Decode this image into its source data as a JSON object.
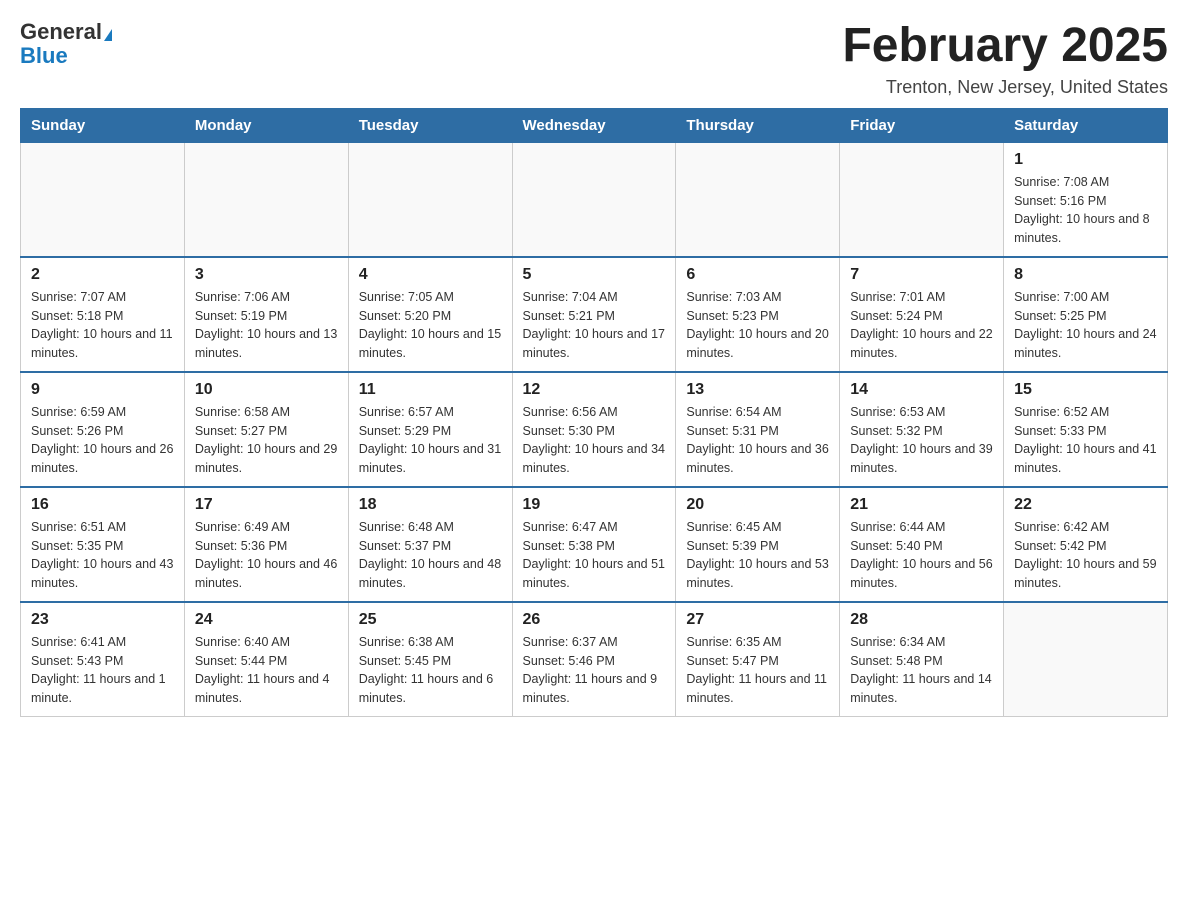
{
  "logo": {
    "general": "General",
    "blue": "Blue",
    "triangle": "▲"
  },
  "title": {
    "month_year": "February 2025",
    "location": "Trenton, New Jersey, United States"
  },
  "weekdays": [
    "Sunday",
    "Monday",
    "Tuesday",
    "Wednesday",
    "Thursday",
    "Friday",
    "Saturday"
  ],
  "weeks": [
    [
      {
        "day": "",
        "info": ""
      },
      {
        "day": "",
        "info": ""
      },
      {
        "day": "",
        "info": ""
      },
      {
        "day": "",
        "info": ""
      },
      {
        "day": "",
        "info": ""
      },
      {
        "day": "",
        "info": ""
      },
      {
        "day": "1",
        "info": "Sunrise: 7:08 AM\nSunset: 5:16 PM\nDaylight: 10 hours and 8 minutes."
      }
    ],
    [
      {
        "day": "2",
        "info": "Sunrise: 7:07 AM\nSunset: 5:18 PM\nDaylight: 10 hours and 11 minutes."
      },
      {
        "day": "3",
        "info": "Sunrise: 7:06 AM\nSunset: 5:19 PM\nDaylight: 10 hours and 13 minutes."
      },
      {
        "day": "4",
        "info": "Sunrise: 7:05 AM\nSunset: 5:20 PM\nDaylight: 10 hours and 15 minutes."
      },
      {
        "day": "5",
        "info": "Sunrise: 7:04 AM\nSunset: 5:21 PM\nDaylight: 10 hours and 17 minutes."
      },
      {
        "day": "6",
        "info": "Sunrise: 7:03 AM\nSunset: 5:23 PM\nDaylight: 10 hours and 20 minutes."
      },
      {
        "day": "7",
        "info": "Sunrise: 7:01 AM\nSunset: 5:24 PM\nDaylight: 10 hours and 22 minutes."
      },
      {
        "day": "8",
        "info": "Sunrise: 7:00 AM\nSunset: 5:25 PM\nDaylight: 10 hours and 24 minutes."
      }
    ],
    [
      {
        "day": "9",
        "info": "Sunrise: 6:59 AM\nSunset: 5:26 PM\nDaylight: 10 hours and 26 minutes."
      },
      {
        "day": "10",
        "info": "Sunrise: 6:58 AM\nSunset: 5:27 PM\nDaylight: 10 hours and 29 minutes."
      },
      {
        "day": "11",
        "info": "Sunrise: 6:57 AM\nSunset: 5:29 PM\nDaylight: 10 hours and 31 minutes."
      },
      {
        "day": "12",
        "info": "Sunrise: 6:56 AM\nSunset: 5:30 PM\nDaylight: 10 hours and 34 minutes."
      },
      {
        "day": "13",
        "info": "Sunrise: 6:54 AM\nSunset: 5:31 PM\nDaylight: 10 hours and 36 minutes."
      },
      {
        "day": "14",
        "info": "Sunrise: 6:53 AM\nSunset: 5:32 PM\nDaylight: 10 hours and 39 minutes."
      },
      {
        "day": "15",
        "info": "Sunrise: 6:52 AM\nSunset: 5:33 PM\nDaylight: 10 hours and 41 minutes."
      }
    ],
    [
      {
        "day": "16",
        "info": "Sunrise: 6:51 AM\nSunset: 5:35 PM\nDaylight: 10 hours and 43 minutes."
      },
      {
        "day": "17",
        "info": "Sunrise: 6:49 AM\nSunset: 5:36 PM\nDaylight: 10 hours and 46 minutes."
      },
      {
        "day": "18",
        "info": "Sunrise: 6:48 AM\nSunset: 5:37 PM\nDaylight: 10 hours and 48 minutes."
      },
      {
        "day": "19",
        "info": "Sunrise: 6:47 AM\nSunset: 5:38 PM\nDaylight: 10 hours and 51 minutes."
      },
      {
        "day": "20",
        "info": "Sunrise: 6:45 AM\nSunset: 5:39 PM\nDaylight: 10 hours and 53 minutes."
      },
      {
        "day": "21",
        "info": "Sunrise: 6:44 AM\nSunset: 5:40 PM\nDaylight: 10 hours and 56 minutes."
      },
      {
        "day": "22",
        "info": "Sunrise: 6:42 AM\nSunset: 5:42 PM\nDaylight: 10 hours and 59 minutes."
      }
    ],
    [
      {
        "day": "23",
        "info": "Sunrise: 6:41 AM\nSunset: 5:43 PM\nDaylight: 11 hours and 1 minute."
      },
      {
        "day": "24",
        "info": "Sunrise: 6:40 AM\nSunset: 5:44 PM\nDaylight: 11 hours and 4 minutes."
      },
      {
        "day": "25",
        "info": "Sunrise: 6:38 AM\nSunset: 5:45 PM\nDaylight: 11 hours and 6 minutes."
      },
      {
        "day": "26",
        "info": "Sunrise: 6:37 AM\nSunset: 5:46 PM\nDaylight: 11 hours and 9 minutes."
      },
      {
        "day": "27",
        "info": "Sunrise: 6:35 AM\nSunset: 5:47 PM\nDaylight: 11 hours and 11 minutes."
      },
      {
        "day": "28",
        "info": "Sunrise: 6:34 AM\nSunset: 5:48 PM\nDaylight: 11 hours and 14 minutes."
      },
      {
        "day": "",
        "info": ""
      }
    ]
  ]
}
